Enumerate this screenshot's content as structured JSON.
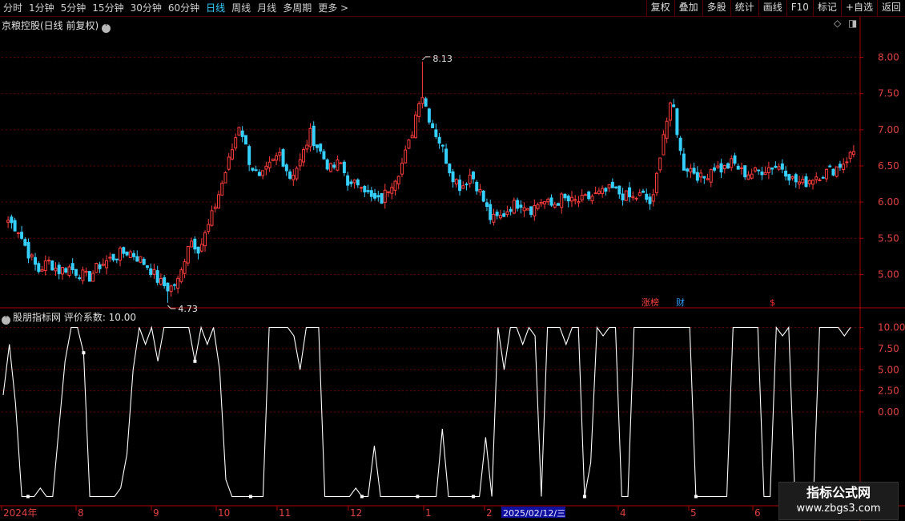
{
  "toolbar": {
    "periods": [
      "分时",
      "1分钟",
      "5分钟",
      "15分钟",
      "30分钟",
      "60分钟",
      "日线",
      "周线",
      "月线",
      "多周期",
      "更多 >"
    ],
    "active_period": "日线",
    "right_buttons": [
      "复权",
      "叠加",
      "多股",
      "统计",
      "画线",
      "F10",
      "标记",
      "+自选",
      "返回"
    ]
  },
  "main_panel": {
    "title": "京粮控股(日线 前复权)",
    "title_icon": "chevron-down-icon"
  },
  "indicator_panel": {
    "title": "股朋指标网 评价系数: 10.00"
  },
  "markers": {
    "zhangbang": "涨榜",
    "cai": "财",
    "dollar": "$"
  },
  "colors": {
    "up": "#ff3c3c",
    "down": "#35d0ff",
    "grid": "#6a0000",
    "axis": "#b00000",
    "line": "#ffffff"
  },
  "chart_data": [
    {
      "type": "candlestick",
      "title": "京粮控股(日线 前复权)",
      "ylim": [
        4.55,
        8.35
      ],
      "yticks": [
        "8.00",
        "7.50",
        "7.00",
        "6.50",
        "6.00",
        "5.50",
        "5.00"
      ],
      "annotations": {
        "max_label": "8.13",
        "min_label": "4.73"
      },
      "close_path": [
        5.75,
        5.62,
        5.3,
        5.05,
        5.18,
        5.05,
        5.1,
        5.02,
        4.95,
        5.12,
        5.2,
        5.28,
        5.32,
        5.22,
        5.1,
        4.9,
        4.8,
        4.92,
        5.5,
        5.35,
        5.7,
        6.15,
        6.6,
        7.1,
        6.55,
        6.3,
        6.5,
        6.68,
        6.35,
        6.55,
        6.95,
        6.7,
        6.45,
        6.55,
        6.2,
        6.3,
        6.05,
        6.0,
        6.25,
        6.48,
        6.88,
        7.55,
        7.1,
        6.8,
        6.4,
        6.2,
        6.4,
        6.1,
        5.75,
        5.8,
        5.95,
        6.0,
        5.9,
        6.02,
        5.95,
        6.05,
        6.0,
        6.02,
        6.08,
        6.12,
        6.18,
        6.1,
        6.05,
        6.1,
        5.95,
        6.9,
        7.4,
        6.5,
        6.45,
        6.3,
        6.5,
        6.45,
        6.55,
        6.4,
        6.4,
        6.45,
        6.5,
        6.48,
        6.3,
        6.25,
        6.35,
        6.4,
        6.45,
        6.55,
        6.7
      ],
      "x": [
        "2024年",
        "8",
        "9",
        "10",
        "11",
        "12",
        "1",
        "2",
        "2025/02/12/三",
        "4",
        "5",
        "6"
      ]
    },
    {
      "type": "line",
      "title": "股朋指标网 评价系数",
      "ylim": [
        -11.0,
        11.0
      ],
      "yticks": [
        "10.00",
        "7.50",
        "5.00",
        "2.50",
        "0.00"
      ],
      "latest_value": 10.0,
      "levels": [
        2,
        8,
        1,
        -10,
        -10,
        -10,
        -9,
        -10,
        -10,
        -2,
        6,
        10,
        10,
        7,
        -10,
        -10,
        -10,
        -10,
        -10,
        -9,
        -5,
        5,
        10,
        8,
        10,
        6,
        10,
        10,
        10,
        10,
        10,
        6,
        10,
        8,
        10,
        5,
        -8,
        -10,
        -10,
        -10,
        -10,
        -10,
        -10,
        10,
        10,
        10,
        10,
        9,
        5,
        10,
        10,
        10,
        -10,
        -10,
        -10,
        -10,
        -10,
        -9,
        -10,
        -10,
        -4,
        -10,
        -10,
        -10,
        -10,
        -10,
        -10,
        -10,
        -10,
        -10,
        -10,
        -2,
        -10,
        -10,
        -10,
        -10,
        -10,
        -10,
        -3,
        -10,
        10,
        5,
        10,
        10,
        8,
        10,
        9,
        -10,
        10,
        10,
        10,
        8,
        10,
        10,
        -10,
        -6,
        10,
        9,
        10,
        10,
        -10,
        -10,
        10,
        10,
        10,
        10,
        10,
        10,
        10,
        10,
        10,
        10,
        -10,
        -10,
        -10,
        -10,
        -10,
        -10,
        10,
        10,
        10,
        10,
        10,
        -10,
        -10,
        10,
        9,
        10,
        -10,
        -10,
        -10,
        -10,
        10,
        10,
        10,
        10,
        9,
        10
      ]
    }
  ],
  "watermark": {
    "line1": "指标公式网",
    "line2": "www.zbgs3.com"
  }
}
